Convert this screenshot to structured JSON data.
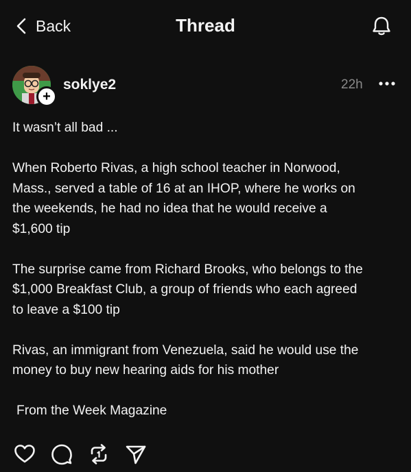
{
  "header": {
    "back_label": "Back",
    "title": "Thread"
  },
  "post": {
    "username": "soklye2",
    "timestamp": "22h",
    "lines": [
      "It wasn’t all bad ...",
      "",
      "When Roberto Rivas, a high school teacher in Norwood,",
      "Mass., served a table of 16 at an IHOP, where he works on",
      "the weekends, he had no idea that he would receive a",
      "$1,600 tip",
      "",
      "The surprise came from Richard Brooks, who belongs to the",
      "$1,000 Breakfast Club, a group of friends who each agreed",
      "to leave a $100 tip",
      "",
      "Rivas, an immigrant from Venezuela, said he would use the",
      "money to buy new hearing aids for his mother",
      "",
      "From the Week Magazine"
    ]
  },
  "icons": {
    "back": "chevron-left-icon",
    "notifications": "bell-icon",
    "follow": "plus-icon",
    "more": "more-horizontal-icon",
    "like": "heart-icon",
    "reply": "comment-icon",
    "repost": "repost-icon",
    "share": "send-icon"
  },
  "colors": {
    "background": "#101010",
    "text": "#f3f3f3",
    "muted": "#8a8a8a"
  }
}
